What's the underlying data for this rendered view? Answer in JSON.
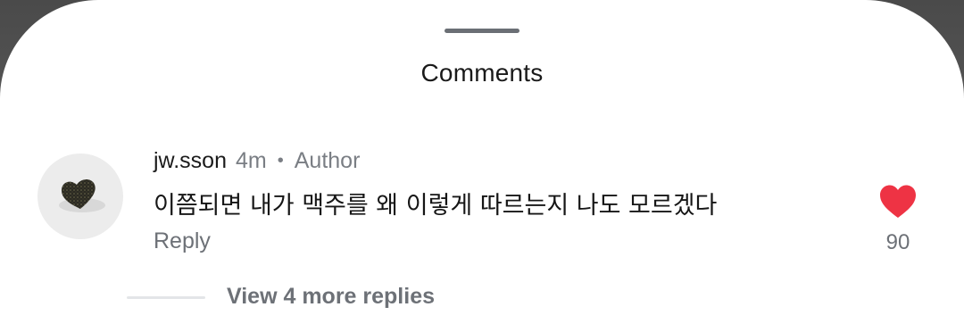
{
  "sheet": {
    "title": "Comments"
  },
  "comment": {
    "username": "jw.sson",
    "time": "4m",
    "separator": "•",
    "badge": "Author",
    "text": "이쯤되면 내가 맥주를 왜 이렇게 따르는지 나도 모르겠다",
    "reply_label": "Reply",
    "like_count": "90",
    "liked": true,
    "like_color": "#ee3344"
  },
  "replies": {
    "view_label": "View 4 more replies"
  },
  "icons": {
    "like": "heart-filled-icon",
    "avatar": "avatar-image"
  }
}
